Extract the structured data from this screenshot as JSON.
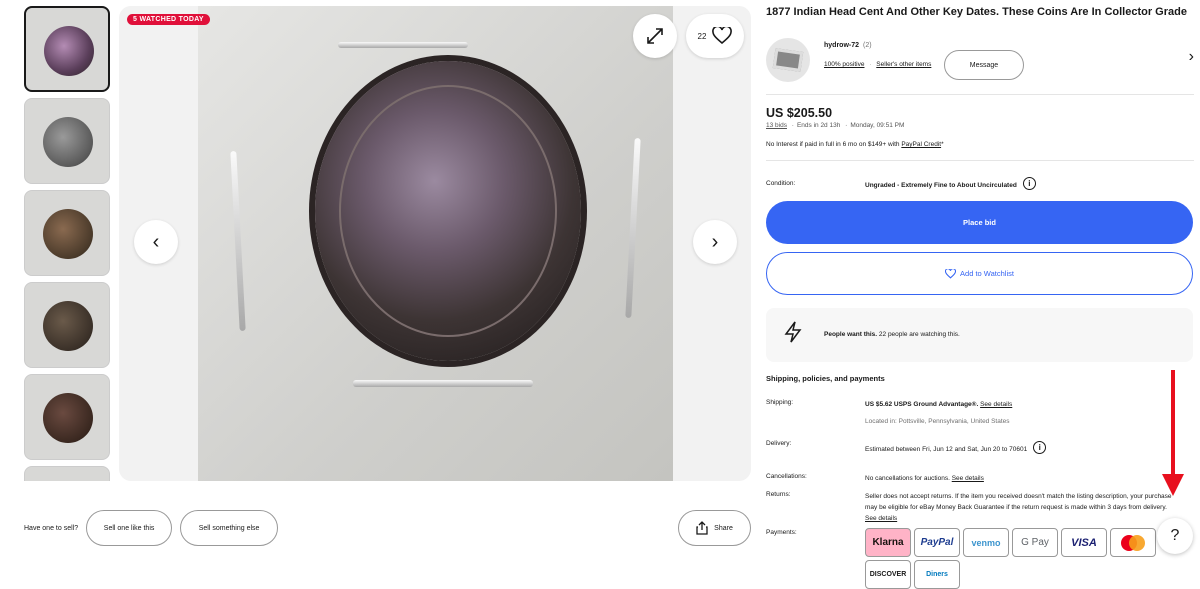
{
  "gallery": {
    "watched_badge": "5 WATCHED TODAY",
    "watch_count": "22",
    "thumbnail_count": 5
  },
  "sell_bar": {
    "prompt": "Have one to sell?",
    "sell_like": "Sell one like this",
    "sell_else": "Sell something else",
    "share": "Share"
  },
  "listing": {
    "title": "1877 Indian Head Cent And Other Key Dates. These Coins Are In Collector Grade",
    "seller_name": "hydrow-72",
    "seller_score": "(2)",
    "feedback": "100% positive",
    "other_items": "Seller's other items",
    "message": "Message",
    "price": "US $205.50",
    "bids": "13 bids",
    "ends": "Ends in 2d 13h",
    "end_time": "Monday, 09:51 PM",
    "credit_text": "No Interest if paid in full in 6 mo on $149+ with",
    "credit_link": "PayPal Credit",
    "credit_suffix": "*",
    "condition_label": "Condition:",
    "condition_value": "Ungraded - Extremely Fine to About Uncirculated",
    "place_bid": "Place bid",
    "add_watchlist": "Add to Watchlist",
    "people_bold": "People want this.",
    "people_text": "22 people are watching this.",
    "shipping_heading": "Shipping, policies, and payments",
    "shipping_label": "Shipping:",
    "shipping_value": "US $5.62 USPS Ground Advantage®.",
    "see_details": "See details",
    "located": "Located in: Pottsville, Pennsylvania, United States",
    "delivery_label": "Delivery:",
    "delivery_value": "Estimated between Fri, Jun 12 and Sat, Jun 20 to 70601",
    "cancel_label": "Cancellations:",
    "cancel_value": "No cancellations for auctions.",
    "returns_label": "Returns:",
    "returns_value": "Seller does not accept returns. If the item you received doesn't match the listing description, your purchase may be eligible for eBay Money Back Guarantee if the return request is made within 3 days from delivery.",
    "payments_label": "Payments:",
    "payment_methods": [
      "Klarna",
      "PayPal",
      "venmo",
      "G Pay",
      "VISA",
      "Mastercard",
      "DISCOVER",
      "Diners"
    ]
  },
  "help": "?",
  "colors": {
    "accent": "#3665f3",
    "badge": "#e0103a",
    "arrow": "#e8101e"
  }
}
